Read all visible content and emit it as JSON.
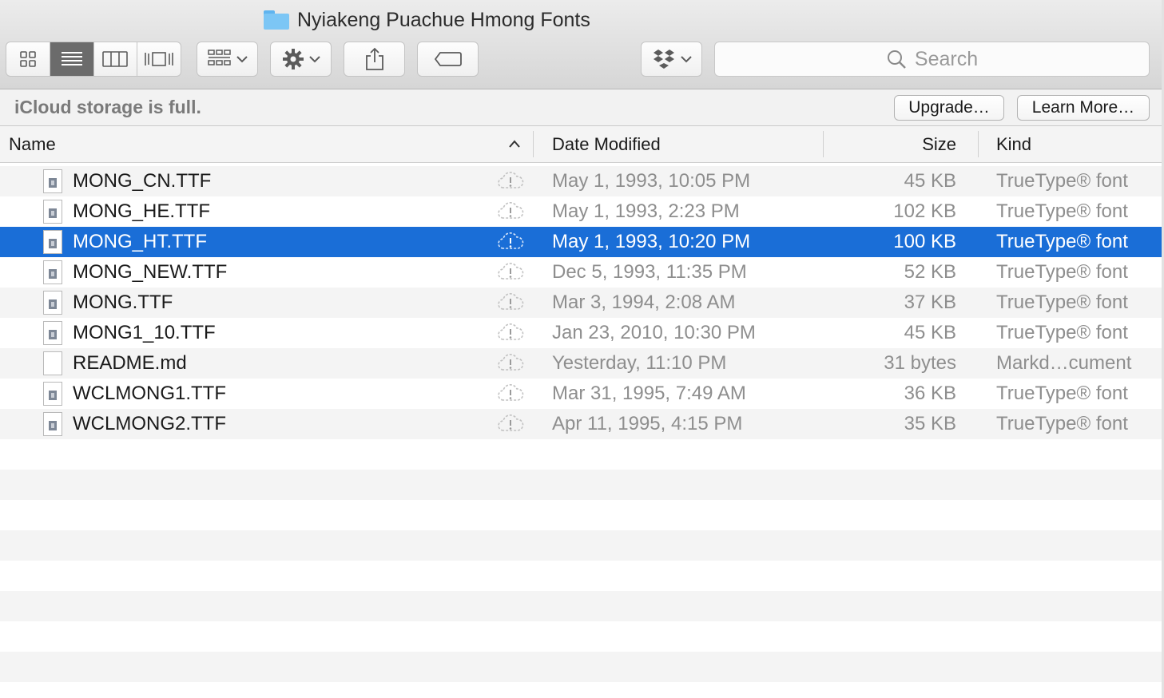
{
  "window": {
    "title": "Nyiakeng Puachue Hmong Fonts",
    "title_icon": "folder-icon"
  },
  "toolbar": {
    "view_modes": [
      "icon-view-icon",
      "list-view-icon",
      "column-view-icon",
      "cover-flow-icon"
    ],
    "active_view": "list",
    "arrange_icon": "arrange-grid-icon",
    "action_icon": "gear-icon",
    "share_icon": "share-icon",
    "tag_icon": "tag-icon",
    "dropbox_icon": "dropbox-icon",
    "search_placeholder": "Search"
  },
  "notice": {
    "text": "iCloud storage is full.",
    "upgrade_label": "Upgrade…",
    "learn_more_label": "Learn More…"
  },
  "columns": {
    "name": "Name",
    "date_modified": "Date Modified",
    "size": "Size",
    "kind": "Kind",
    "sort_indicator": "ascending"
  },
  "files": [
    {
      "name": "MONG_CN.TTF",
      "date": "May 1, 1993, 10:05 PM",
      "size": "45 KB",
      "kind": "TrueType® font",
      "icon": "font-file-icon",
      "selected": false
    },
    {
      "name": "MONG_HE.TTF",
      "date": "May 1, 1993, 2:23 PM",
      "size": "102 KB",
      "kind": "TrueType® font",
      "icon": "font-file-icon",
      "selected": false
    },
    {
      "name": "MONG_HT.TTF",
      "date": "May 1, 1993, 10:20 PM",
      "size": "100 KB",
      "kind": "TrueType® font",
      "icon": "font-file-icon",
      "selected": true
    },
    {
      "name": "MONG_NEW.TTF",
      "date": "Dec 5, 1993, 11:35 PM",
      "size": "52 KB",
      "kind": "TrueType® font",
      "icon": "font-file-icon",
      "selected": false
    },
    {
      "name": "MONG.TTF",
      "date": "Mar 3, 1994, 2:08 AM",
      "size": "37 KB",
      "kind": "TrueType® font",
      "icon": "font-file-icon",
      "selected": false
    },
    {
      "name": "MONG1_10.TTF",
      "date": "Jan 23, 2010, 10:30 PM",
      "size": "45 KB",
      "kind": "TrueType® font",
      "icon": "font-file-icon",
      "selected": false
    },
    {
      "name": "README.md",
      "date": "Yesterday, 11:10 PM",
      "size": "31 bytes",
      "kind": "Markd…cument",
      "icon": "text-file-icon",
      "selected": false
    },
    {
      "name": "WCLMONG1.TTF",
      "date": "Mar 31, 1995, 7:49 AM",
      "size": "36 KB",
      "kind": "TrueType® font",
      "icon": "font-file-icon",
      "selected": false
    },
    {
      "name": "WCLMONG2.TTF",
      "date": "Apr 11, 1995, 4:15 PM",
      "size": "35 KB",
      "kind": "TrueType® font",
      "icon": "font-file-icon",
      "selected": false
    }
  ],
  "row_status_icon": "icloud-warning-icon",
  "colors": {
    "selection": "#1a6ed7",
    "alt_row": "#f4f4f4",
    "folder": "#7cc6f5"
  }
}
